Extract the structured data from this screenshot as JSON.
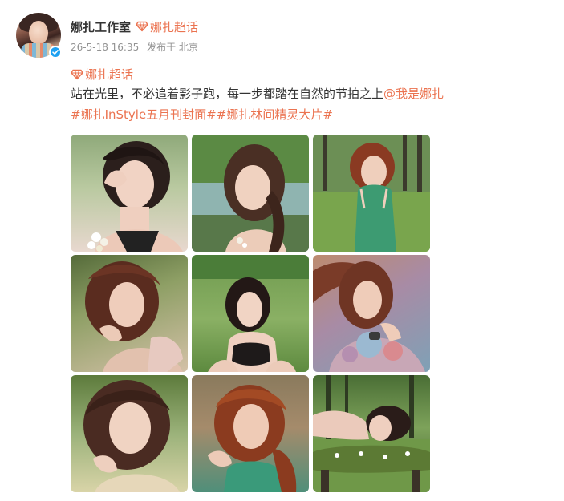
{
  "post": {
    "author": {
      "name": "娜扎工作室",
      "super_topic_label": "娜扎超话",
      "avatar_icon": "avatar-image",
      "verified_icon": "blue-verified-badge-icon"
    },
    "meta": {
      "timestamp": "26-5-18 16:35",
      "source": "发布于 北京"
    },
    "body": {
      "topic": "娜扎超话",
      "text": "站在光里，不必追着影子跑，每一步都踏在自然的节拍之上",
      "mention": "@我是娜扎",
      "tags": "#娜扎InStyle五月刊封面##娜扎林间精灵大片#"
    },
    "colors": {
      "accent": "#eb7350",
      "text": "#333333",
      "meta": "#939393",
      "verified": "#1da1f2"
    },
    "photos": [
      {
        "scene": "woman-with-dark-curly-hair-holding-flowers-green-background"
      },
      {
        "scene": "woman-by-lake-green-trees"
      },
      {
        "scene": "woman-in-green-satin-dress-forest"
      },
      {
        "scene": "woman-windblown-hair-pink-top"
      },
      {
        "scene": "woman-in-black-top-on-grass"
      },
      {
        "scene": "woman-in-floral-top-with-watch"
      },
      {
        "scene": "woman-closeup-curly-hair-outdoors"
      },
      {
        "scene": "woman-red-hair-green-satin-dress"
      },
      {
        "scene": "woman-lying-on-mossy-log-forest"
      }
    ]
  }
}
